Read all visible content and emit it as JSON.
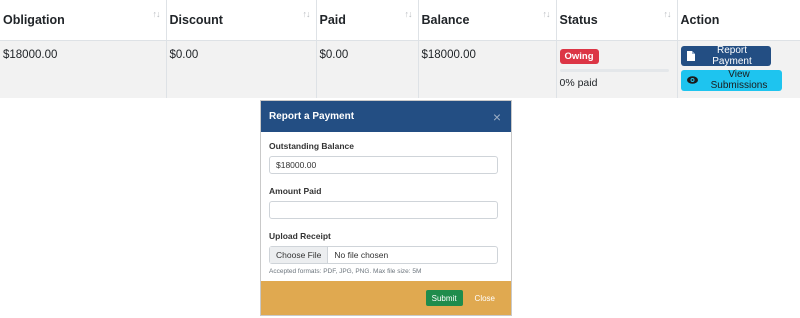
{
  "table": {
    "headers": {
      "obligation": "Obligation",
      "discount": "Discount",
      "paid": "Paid",
      "balance": "Balance",
      "status": "Status",
      "action": "Action"
    },
    "sort_icon": "↑↓",
    "row": {
      "obligation": "$18000.00",
      "discount": "$0.00",
      "paid": "$0.00",
      "balance": "$18000.00",
      "status_badge": "Owing",
      "status_color": "#dc3545",
      "progress_percent": 0,
      "progress_text": "0% paid",
      "report_button": "Report Payment",
      "report_icon": "file-icon",
      "view_button": "View Submissions",
      "view_icon": "eye-icon"
    }
  },
  "modal": {
    "title": "Report a Payment",
    "close_icon": "×",
    "outstanding_label": "Outstanding Balance",
    "outstanding_value": "$18000.00",
    "amount_label": "Amount Paid",
    "amount_value": "",
    "upload_label": "Upload Receipt",
    "choose_file": "Choose File",
    "file_status": "No file chosen",
    "hint": "Accepted formats: PDF, JPG, PNG. Max file size: 5M",
    "submit": "Submit",
    "close": "Close",
    "header_color": "#234e83",
    "footer_color": "#e0a950"
  }
}
